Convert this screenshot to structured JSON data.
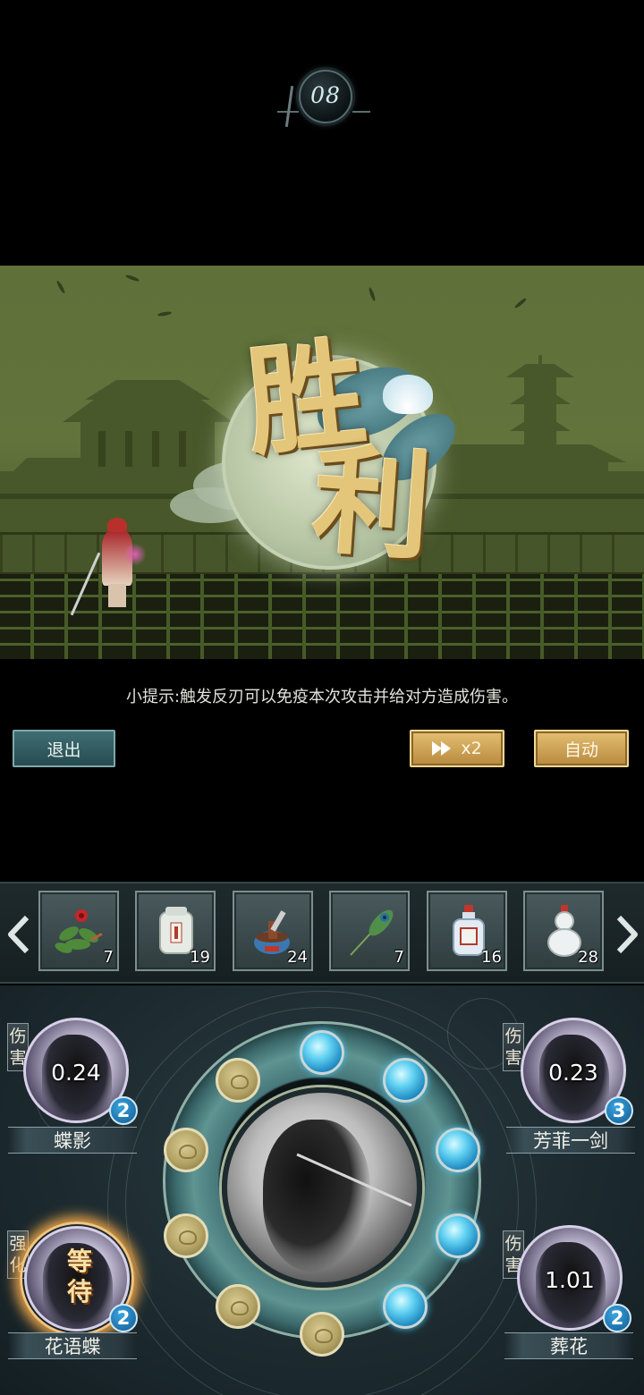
{
  "round": {
    "number": "08"
  },
  "scene": {
    "victory_char_1": "胜",
    "victory_char_2": "利"
  },
  "tip": {
    "text": "小提示:触发反刃可以免疫本次攻击并给对方造成伤害。"
  },
  "controls": {
    "exit_label": "退出",
    "speed_label": "x2",
    "speed_icon": "fast-forward-icon",
    "auto_label": "自动"
  },
  "items": [
    {
      "icon": "red-flower-herb-icon",
      "count": "7"
    },
    {
      "icon": "jade-medicine-jar-icon",
      "count": "19"
    },
    {
      "icon": "mortar-pestle-icon",
      "count": "24"
    },
    {
      "icon": "peacock-feather-icon",
      "count": "7"
    },
    {
      "icon": "porcelain-bottle-icon",
      "count": "16"
    },
    {
      "icon": "gourd-flask-icon",
      "count": "28"
    }
  ],
  "items_nav": {
    "prev_icon": "chevron-left-icon",
    "next_icon": "chevron-right-icon"
  },
  "skills": {
    "top_left": {
      "name": "蝶影",
      "tag": "伤害",
      "cooldown": "0.24",
      "level": "2"
    },
    "top_right": {
      "name": "芳菲一剑",
      "tag": "伤害",
      "cooldown": "0.23",
      "level": "3"
    },
    "bottom_left": {
      "name": "花语蝶",
      "tag": "强化",
      "status": "等待",
      "level": "2"
    },
    "bottom_right": {
      "name": "葬花",
      "tag": "伤害",
      "cooldown": "1.01",
      "level": "2"
    }
  },
  "energy_wheel": {
    "filled_orbs": 6,
    "empty_orbs": 4,
    "total_orbs": 10
  },
  "colors": {
    "scene_green": "#5f7039",
    "gold_button": "#d2aa5a",
    "teal_button": "#335e63",
    "energy_blue": "#3fb6e6",
    "level_badge": "#2a86c3"
  }
}
